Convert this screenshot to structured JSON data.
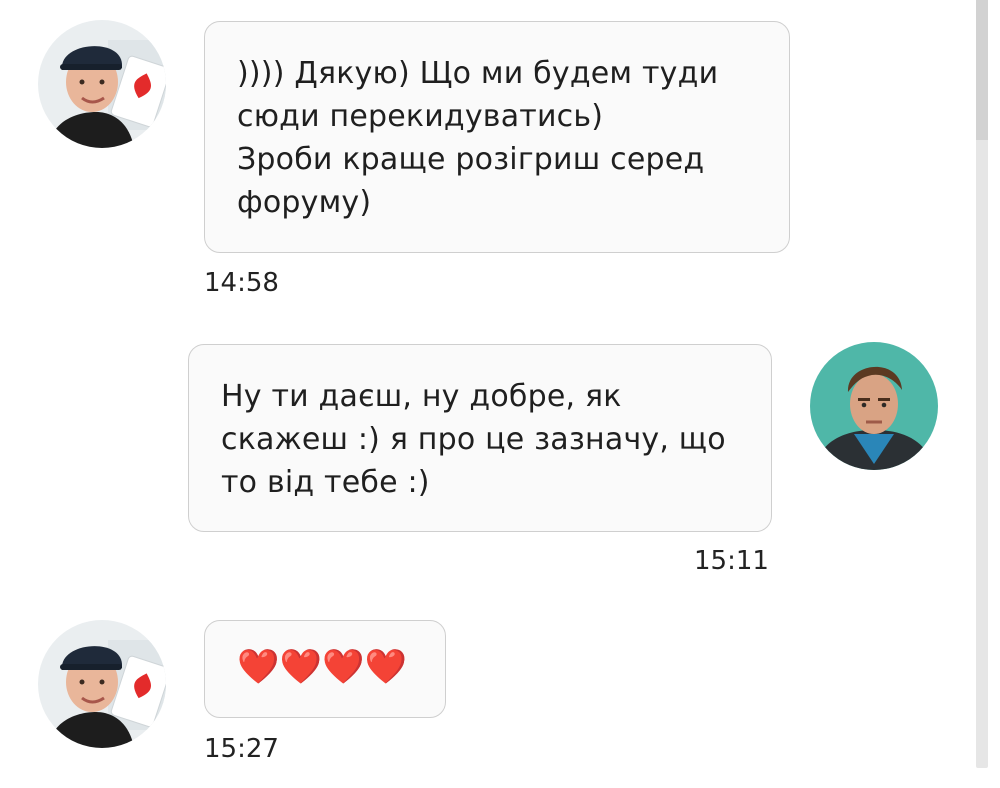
{
  "messages": [
    {
      "sender": "other",
      "text": ")))) Дякую) Що ми будем туди\nсюди перекидуватись)\nЗроби краще розігриш серед\nфоруму)",
      "time": "14:58"
    },
    {
      "sender": "self",
      "text": "Ну ти даєш, ну добре, як\nскажеш :) я про це зазначу, що\nто від тебе :)",
      "time": "15:11"
    },
    {
      "sender": "other",
      "text": "❤️❤️❤️❤️",
      "time": "15:27"
    }
  ],
  "colors": {
    "bubble_border": "#cfcfcf",
    "bubble_bg": "#fafafa",
    "heart": "#e8333b",
    "self_avatar_bg": "#4fb7a8",
    "other_avatar_card": "#f2f2f2"
  },
  "icons": {
    "other_avatar": "user-photo-avatar",
    "self_avatar": "user-photo-avatar"
  }
}
